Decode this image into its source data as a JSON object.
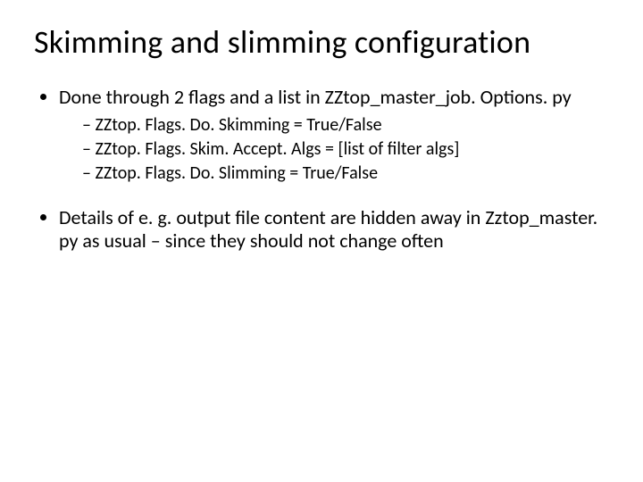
{
  "title": "Skimming and slimming configuration",
  "bullets": [
    {
      "text": "Done through 2 flags and a list in ZZtop_master_job. Options. py",
      "sub": [
        "ZZtop. Flags. Do. Skimming = True/False",
        "ZZtop. Flags. Skim. Accept. Algs = [list of filter algs]",
        "ZZtop. Flags. Do. Slimming = True/False"
      ]
    },
    {
      "text": "Details of e. g. output file content are hidden away in Zztop_master. py as usual – since they should not change often",
      "sub": []
    }
  ]
}
